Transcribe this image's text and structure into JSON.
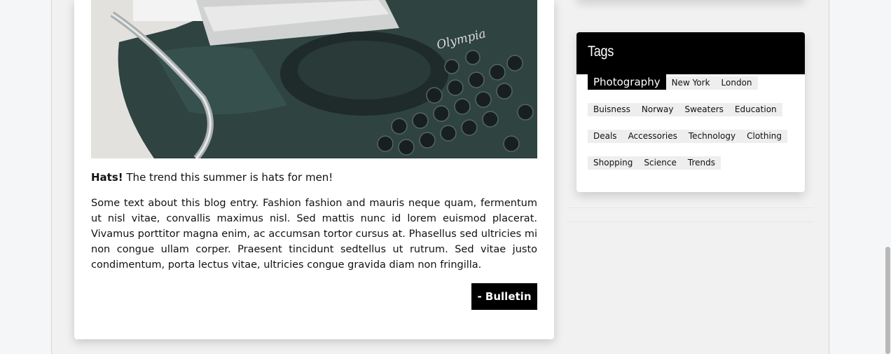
{
  "post": {
    "headline_strong": "Hats!",
    "headline_rest": " The trend this summer is hats for men!",
    "body": "Some text about this blog entry. Fashion fashion and mauris neque quam, fermentum ut nisl vitae, convallis maximus nisl. Sed mattis nunc id lorem euismod placerat. Vivamus porttitor magna enim, ac accumsan tortor cursus at. Phasellus sed ultricies mi non congue ullam corper. Praesent tincidunt sedtellus ut rutrum. Sed vitae justo condimentum, porta lectus vitae, ultricies congue gravida diam non fringilla.",
    "author_button": "- Bulletin",
    "image_brand_text": "Olympia"
  },
  "tags_widget": {
    "title": "Tags",
    "rows": [
      [
        "Photography",
        "New York",
        "London"
      ],
      [
        "Buisness",
        "Norway",
        "Sweaters",
        "Education"
      ],
      [
        "Deals",
        "Accessories",
        "Technology",
        "Clothing"
      ],
      [
        "Shopping",
        "Science",
        "Trends"
      ]
    ],
    "active_tag": "Photography"
  },
  "colors": {
    "accent": "#000000",
    "tag_bg": "#eeeeee",
    "page_bg": "#f1f1f1"
  }
}
